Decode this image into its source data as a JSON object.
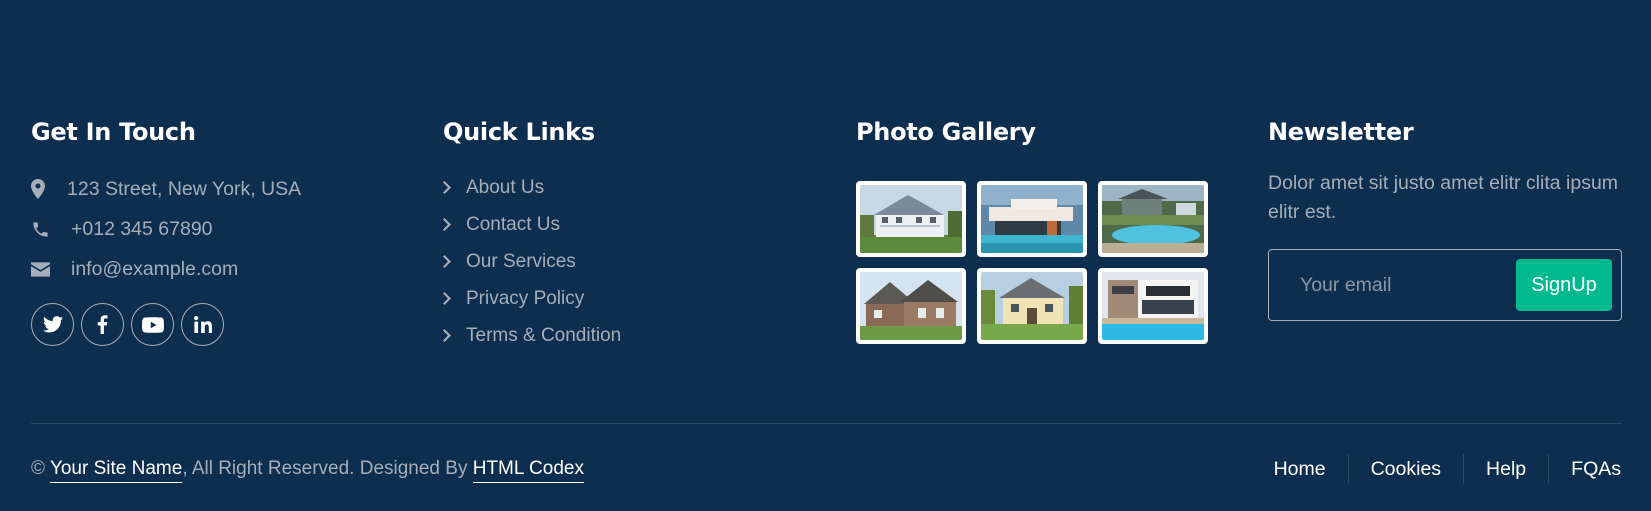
{
  "contact": {
    "title": "Get In Touch",
    "address": "123 Street, New York, USA",
    "phone": "+012 345 67890",
    "email": "info@example.com",
    "icons": [
      "map-marker-icon",
      "phone-icon",
      "envelope-icon"
    ],
    "socials": [
      "twitter-icon",
      "facebook-icon",
      "youtube-icon",
      "linkedin-icon"
    ]
  },
  "quick_links": {
    "title": "Quick Links",
    "items": [
      "About Us",
      "Contact Us",
      "Our Services",
      "Privacy Policy",
      "Terms & Condition"
    ]
  },
  "gallery": {
    "title": "Photo Gallery",
    "images": [
      "house-photo",
      "modern-house-pool-photo",
      "pool-house-photo",
      "brick-house-photo",
      "suburban-house-photo",
      "modern-villa-pool-photo"
    ]
  },
  "newsletter": {
    "title": "Newsletter",
    "text": "Dolor amet sit justo amet elitr clita ipsum elitr est.",
    "placeholder": "Your email",
    "button": "SignUp"
  },
  "bottom": {
    "copyright_symbol": "©",
    "site_name": "Your Site Name",
    "rights": ", All Right Reserved. Designed By ",
    "designer": "HTML Codex",
    "nav": [
      "Home",
      "Cookies",
      "Help",
      "FQAs"
    ]
  },
  "colors": {
    "background": "#0e2e50",
    "accent": "#00b98e",
    "muted_text": "#a5aeb8"
  }
}
